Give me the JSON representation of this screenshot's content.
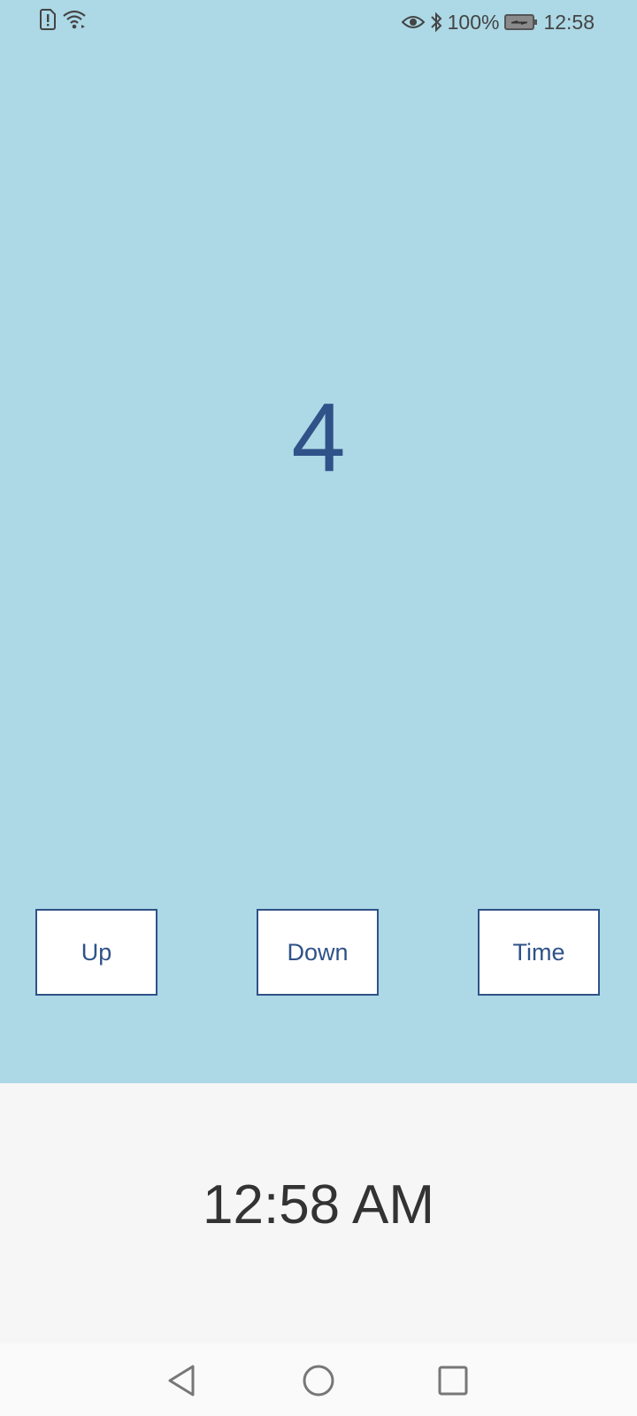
{
  "status_bar": {
    "battery_percent": "100%",
    "clock": "12:58",
    "icons": [
      "sim-alert-icon",
      "wifi-icon",
      "eye-icon",
      "bluetooth-icon",
      "battery-charging-icon"
    ]
  },
  "counter": {
    "value": "4"
  },
  "buttons": {
    "up_label": "Up",
    "down_label": "Down",
    "time_label": "Time"
  },
  "time_display": {
    "value": "12:58 AM"
  },
  "nav_bar": {
    "icons": [
      "back-icon",
      "home-icon",
      "recents-icon"
    ]
  },
  "colors": {
    "background": "#add8e6",
    "accent": "#2f5289",
    "bottom_panel": "#f6f6f6"
  }
}
